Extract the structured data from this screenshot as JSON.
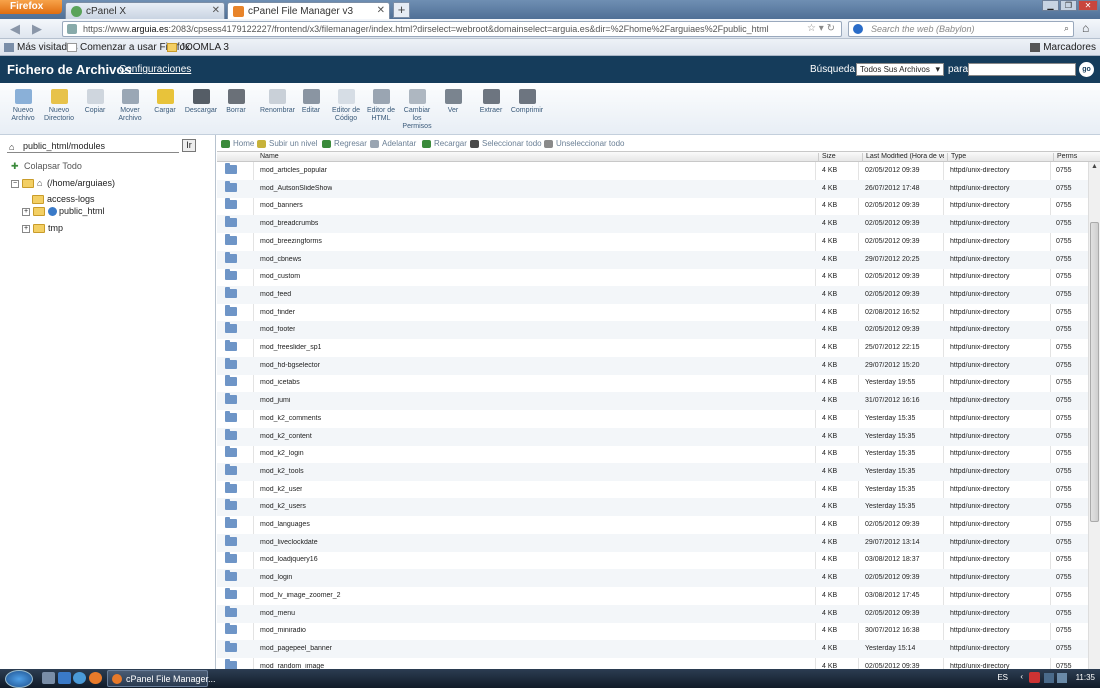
{
  "browser": {
    "menu_label": "Firefox",
    "tabs": [
      {
        "title": "cPanel X"
      },
      {
        "title": "cPanel File Manager v3"
      }
    ],
    "url_prefix": "https://www.",
    "url_domain": "arguia.es",
    "url_rest": ":2083/cpsess4179122227/frontend/x3/filemanager/index.html?dirselect=webroot&domainselect=arguia.es&dir=%2Fhome%2Farguiaes%2Fpublic_html",
    "search_placeholder": "Search the web (Babylon)",
    "bookmarks": [
      "Más visitados",
      "Comenzar a usar Firefox",
      "JOOMLA 3"
    ],
    "bookmarks_menu": "Marcadores"
  },
  "header": {
    "title": "Fichero de Archivos",
    "config_link": "Configuraciones",
    "search_label": "Búsqueda",
    "search_scope": "Todos Sus Archivos",
    "para_label": "para",
    "go_label": "go"
  },
  "toolbar": [
    {
      "label": "Nuevo Archivo",
      "icon": "new-file-icon",
      "color": "#8ab0d8"
    },
    {
      "label": "Nuevo Directorio",
      "icon": "new-folder-icon",
      "color": "#e7c24a"
    },
    {
      "label": "Copiar",
      "icon": "copy-icon",
      "color": "#cfd6de"
    },
    {
      "label": "Mover Archivo",
      "icon": "move-icon",
      "color": "#9aa7b5"
    },
    {
      "label": "Cargar",
      "icon": "upload-icon",
      "color": "#e8c33a"
    },
    {
      "label": "Descargar",
      "icon": "download-icon",
      "color": "#555d66"
    },
    {
      "label": "Borrar",
      "icon": "delete-icon",
      "color": "#6a7078"
    },
    {
      "label": "Renombrar",
      "icon": "rename-icon",
      "color": "#c9d0d8"
    },
    {
      "label": "Editar",
      "icon": "edit-icon",
      "color": "#8a95a2"
    },
    {
      "label": "Editor de Código",
      "icon": "code-editor-icon",
      "color": "#d6dde5"
    },
    {
      "label": "Editor de HTML",
      "icon": "html-editor-icon",
      "color": "#9aa5b2"
    },
    {
      "label": "Cambiar los Permisos",
      "icon": "permissions-icon",
      "color": "#aeb7c1"
    },
    {
      "label": "Ver",
      "icon": "view-icon",
      "color": "#7a848f"
    },
    {
      "label": "Extraer",
      "icon": "extract-icon",
      "color": "#6d7580"
    },
    {
      "label": "Comprimir",
      "icon": "compress-icon",
      "color": "#6d7580"
    }
  ],
  "sidebar": {
    "path_value": "public_html/modules",
    "go_label": "Ir",
    "collapse_label": "Colapsar Todo",
    "tree": [
      {
        "label": "(/home/arguiaes)",
        "expander": "−"
      },
      {
        "label": "access-logs",
        "expander": ""
      },
      {
        "label": "public_html",
        "expander": "+"
      },
      {
        "label": "tmp",
        "expander": "+"
      }
    ]
  },
  "filenav": [
    {
      "label": "Home",
      "icon": "home-icon",
      "color": "#3a8a3a"
    },
    {
      "label": "Subir un nivel",
      "icon": "up-level-icon",
      "color": "#c7b23a"
    },
    {
      "label": "Regresar",
      "icon": "back-icon",
      "color": "#3a8a3a"
    },
    {
      "label": "Adelantar",
      "icon": "forward-icon",
      "color": "#9aa5b2"
    },
    {
      "label": "Recargar",
      "icon": "reload-icon",
      "color": "#3a8a3a"
    },
    {
      "label": "Seleccionar todo",
      "icon": "select-all-icon",
      "color": "#4a4a4a"
    },
    {
      "label": "Unseleccionar todo",
      "icon": "unselect-all-icon",
      "color": "#8a8a8a"
    }
  ],
  "columns": [
    "Name",
    "Size",
    "Last Modified (Hora de verano GMT)",
    "Type",
    "Perms"
  ],
  "files": [
    {
      "name": "mod_articles_popular",
      "size": "4 KB",
      "modified": "02/05/2012 09:39",
      "type": "httpd/unix-directory",
      "perms": "0755"
    },
    {
      "name": "mod_AutsonSlideShow",
      "size": "4 KB",
      "modified": "26/07/2012 17:48",
      "type": "httpd/unix-directory",
      "perms": "0755"
    },
    {
      "name": "mod_banners",
      "size": "4 KB",
      "modified": "02/05/2012 09:39",
      "type": "httpd/unix-directory",
      "perms": "0755"
    },
    {
      "name": "mod_breadcrumbs",
      "size": "4 KB",
      "modified": "02/05/2012 09:39",
      "type": "httpd/unix-directory",
      "perms": "0755"
    },
    {
      "name": "mod_breezingforms",
      "size": "4 KB",
      "modified": "02/05/2012 09:39",
      "type": "httpd/unix-directory",
      "perms": "0755"
    },
    {
      "name": "mod_cbnews",
      "size": "4 KB",
      "modified": "29/07/2012 20:25",
      "type": "httpd/unix-directory",
      "perms": "0755"
    },
    {
      "name": "mod_custom",
      "size": "4 KB",
      "modified": "02/05/2012 09:39",
      "type": "httpd/unix-directory",
      "perms": "0755"
    },
    {
      "name": "mod_feed",
      "size": "4 KB",
      "modified": "02/05/2012 09:39",
      "type": "httpd/unix-directory",
      "perms": "0755"
    },
    {
      "name": "mod_finder",
      "size": "4 KB",
      "modified": "02/08/2012 16:52",
      "type": "httpd/unix-directory",
      "perms": "0755"
    },
    {
      "name": "mod_footer",
      "size": "4 KB",
      "modified": "02/05/2012 09:39",
      "type": "httpd/unix-directory",
      "perms": "0755"
    },
    {
      "name": "mod_freeslider_sp1",
      "size": "4 KB",
      "modified": "25/07/2012 22:15",
      "type": "httpd/unix-directory",
      "perms": "0755"
    },
    {
      "name": "mod_hd-bgselector",
      "size": "4 KB",
      "modified": "29/07/2012 15:20",
      "type": "httpd/unix-directory",
      "perms": "0755"
    },
    {
      "name": "mod_icetabs",
      "size": "4 KB",
      "modified": "Yesterday 19:55",
      "type": "httpd/unix-directory",
      "perms": "0755"
    },
    {
      "name": "mod_jumi",
      "size": "4 KB",
      "modified": "31/07/2012 16:16",
      "type": "httpd/unix-directory",
      "perms": "0755"
    },
    {
      "name": "mod_k2_comments",
      "size": "4 KB",
      "modified": "Yesterday 15:35",
      "type": "httpd/unix-directory",
      "perms": "0755"
    },
    {
      "name": "mod_k2_content",
      "size": "4 KB",
      "modified": "Yesterday 15:35",
      "type": "httpd/unix-directory",
      "perms": "0755"
    },
    {
      "name": "mod_k2_login",
      "size": "4 KB",
      "modified": "Yesterday 15:35",
      "type": "httpd/unix-directory",
      "perms": "0755"
    },
    {
      "name": "mod_k2_tools",
      "size": "4 KB",
      "modified": "Yesterday 15:35",
      "type": "httpd/unix-directory",
      "perms": "0755"
    },
    {
      "name": "mod_k2_user",
      "size": "4 KB",
      "modified": "Yesterday 15:35",
      "type": "httpd/unix-directory",
      "perms": "0755"
    },
    {
      "name": "mod_k2_users",
      "size": "4 KB",
      "modified": "Yesterday 15:35",
      "type": "httpd/unix-directory",
      "perms": "0755"
    },
    {
      "name": "mod_languages",
      "size": "4 KB",
      "modified": "02/05/2012 09:39",
      "type": "httpd/unix-directory",
      "perms": "0755"
    },
    {
      "name": "mod_liveclockdate",
      "size": "4 KB",
      "modified": "29/07/2012 13:14",
      "type": "httpd/unix-directory",
      "perms": "0755"
    },
    {
      "name": "mod_loadjquery16",
      "size": "4 KB",
      "modified": "03/08/2012 18:37",
      "type": "httpd/unix-directory",
      "perms": "0755"
    },
    {
      "name": "mod_login",
      "size": "4 KB",
      "modified": "02/05/2012 09:39",
      "type": "httpd/unix-directory",
      "perms": "0755"
    },
    {
      "name": "mod_lv_image_zoomer_2",
      "size": "4 KB",
      "modified": "03/08/2012 17:45",
      "type": "httpd/unix-directory",
      "perms": "0755"
    },
    {
      "name": "mod_menu",
      "size": "4 KB",
      "modified": "02/05/2012 09:39",
      "type": "httpd/unix-directory",
      "perms": "0755"
    },
    {
      "name": "mod_miniradio",
      "size": "4 KB",
      "modified": "30/07/2012 16:38",
      "type": "httpd/unix-directory",
      "perms": "0755"
    },
    {
      "name": "mod_pagepeel_banner",
      "size": "4 KB",
      "modified": "Yesterday 15:14",
      "type": "httpd/unix-directory",
      "perms": "0755"
    },
    {
      "name": "mod_random_image",
      "size": "4 KB",
      "modified": "02/05/2012 09:39",
      "type": "httpd/unix-directory",
      "perms": "0755"
    }
  ],
  "taskbar": {
    "active_task": "cPanel File Manager...",
    "lang": "ES",
    "clock": "11:35"
  }
}
